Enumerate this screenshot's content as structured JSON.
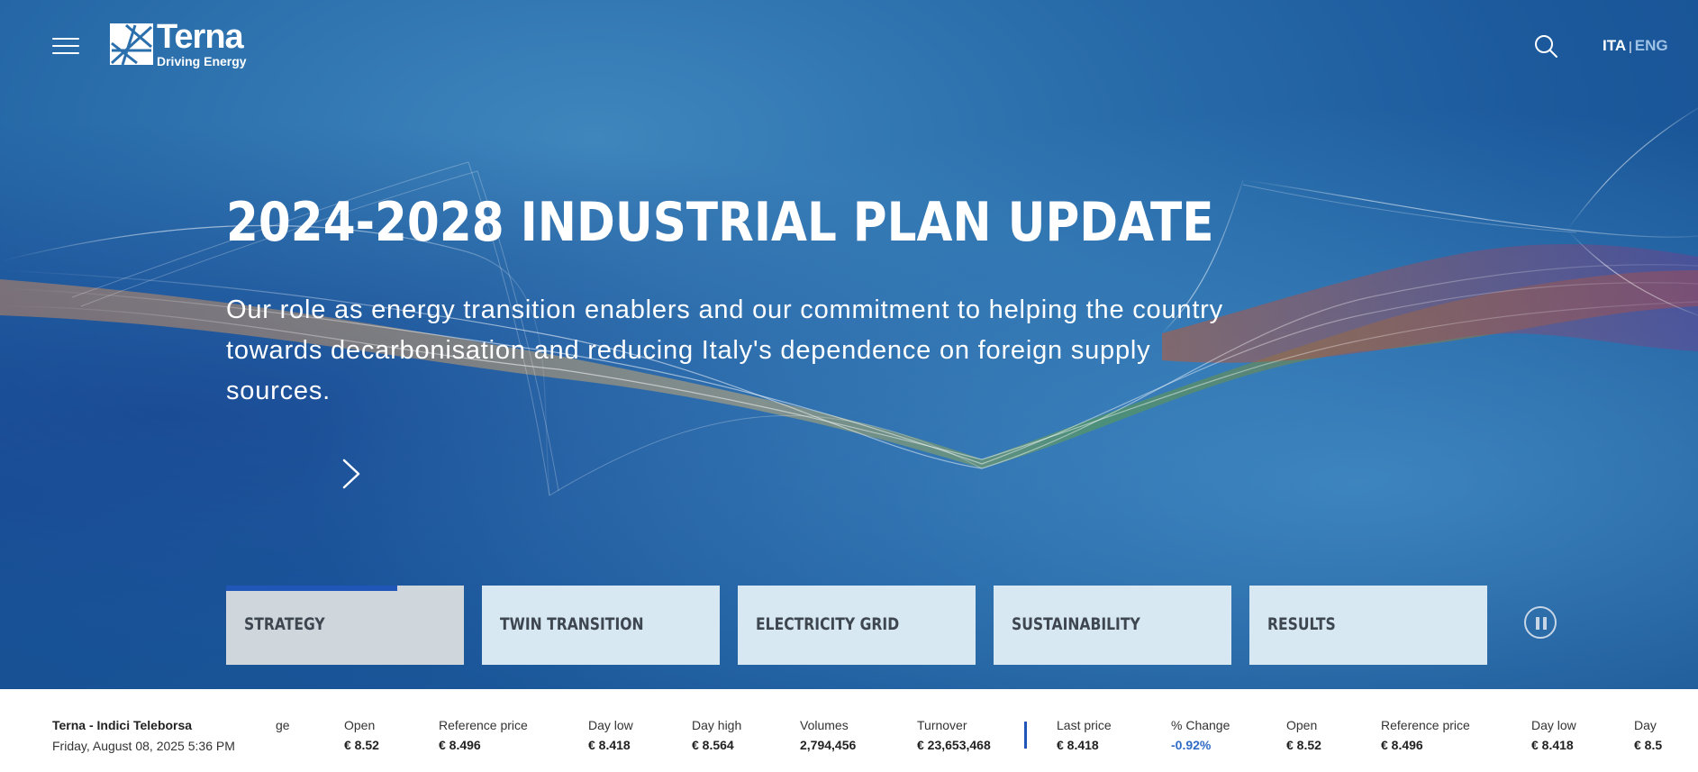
{
  "header": {
    "logo_name": "Terna",
    "logo_tagline": "Driving Energy",
    "lang_ita": "ITA",
    "lang_sep": "|",
    "lang_eng": "ENG"
  },
  "hero": {
    "title": "2024-2028 INDUSTRIAL PLAN UPDATE",
    "subtitle": "Our role as energy transition enablers and our commitment to helping the country towards decarbonisation and reducing Italy's dependence on foreign supply sources."
  },
  "tabs": [
    {
      "label": "STRATEGY",
      "active": true,
      "progress": 0.72
    },
    {
      "label": "TWIN TRANSITION"
    },
    {
      "label": "ELECTRICITY GRID"
    },
    {
      "label": "SUSTAINABILITY"
    },
    {
      "label": "RESULTS"
    }
  ],
  "ticker": {
    "title": "Terna - Indici Teleborsa",
    "date": "Friday, August 08, 2025 5:36 PM",
    "cut_left_label": "ge",
    "items": [
      {
        "k": "Open",
        "v": "€ 8.52"
      },
      {
        "k": "Reference price",
        "v": "€ 8.496"
      },
      {
        "k": "Day low",
        "v": "€ 8.418"
      },
      {
        "k": "Day high",
        "v": "€ 8.564"
      },
      {
        "k": "Volumes",
        "v": "2,794,456"
      },
      {
        "k": "Turnover",
        "v": "€ 23,653,468"
      },
      {
        "k": "Last price",
        "v": "€ 8.418"
      },
      {
        "k": "% Change",
        "v": "-0.92%"
      },
      {
        "k": "Open",
        "v": "€ 8.52"
      },
      {
        "k": "Reference price",
        "v": "€ 8.496"
      },
      {
        "k": "Day low",
        "v": "€ 8.418"
      },
      {
        "k": "Day",
        "v": "€ 8.5"
      }
    ]
  },
  "colors": {
    "accent": "#1f56b8",
    "negative": "#2f6bc6"
  }
}
